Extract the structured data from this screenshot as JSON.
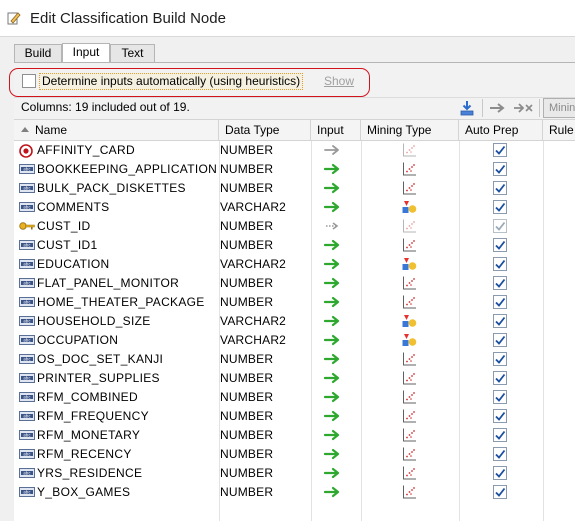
{
  "window": {
    "title": "Edit Classification Build Node"
  },
  "tabs": [
    {
      "label": "Build",
      "active": false
    },
    {
      "label": "Input",
      "active": true
    },
    {
      "label": "Text",
      "active": false
    }
  ],
  "options": {
    "determine_label": "Determine inputs automatically (using heuristics)",
    "determine_checked": false,
    "show_link": "Show"
  },
  "toolbar": {
    "columns_info": "Columns: 19 included out of 19.",
    "mining_button": "Minin"
  },
  "columns": [
    "Name",
    "Data Type",
    "Input",
    "Mining Type",
    "Auto Prep",
    "Rule"
  ],
  "rows": [
    {
      "name": "AFFINITY_CARD",
      "type": "NUMBER",
      "icon": "target-icon",
      "input": "gray",
      "mining": "numeric",
      "mining_dim": true,
      "auto": true,
      "auto_dim": false
    },
    {
      "name": "BOOKKEEPING_APPLICATION",
      "type": "NUMBER",
      "icon": "column-icon",
      "input": "green",
      "mining": "numeric",
      "mining_dim": false,
      "auto": true,
      "auto_dim": false
    },
    {
      "name": "BULK_PACK_DISKETTES",
      "type": "NUMBER",
      "icon": "column-icon",
      "input": "green",
      "mining": "numeric",
      "mining_dim": false,
      "auto": true,
      "auto_dim": false
    },
    {
      "name": "COMMENTS",
      "type": "VARCHAR2",
      "icon": "column-icon",
      "input": "green",
      "mining": "categorical",
      "mining_dim": false,
      "auto": true,
      "auto_dim": false
    },
    {
      "name": "CUST_ID",
      "type": "NUMBER",
      "icon": "key-icon",
      "input": "gray-dotted",
      "mining": "numeric",
      "mining_dim": true,
      "auto": true,
      "auto_dim": true
    },
    {
      "name": "CUST_ID1",
      "type": "NUMBER",
      "icon": "column-icon",
      "input": "green",
      "mining": "numeric",
      "mining_dim": false,
      "auto": true,
      "auto_dim": false
    },
    {
      "name": "EDUCATION",
      "type": "VARCHAR2",
      "icon": "column-icon",
      "input": "green",
      "mining": "categorical",
      "mining_dim": false,
      "auto": true,
      "auto_dim": false
    },
    {
      "name": "FLAT_PANEL_MONITOR",
      "type": "NUMBER",
      "icon": "column-icon",
      "input": "green",
      "mining": "numeric",
      "mining_dim": false,
      "auto": true,
      "auto_dim": false
    },
    {
      "name": "HOME_THEATER_PACKAGE",
      "type": "NUMBER",
      "icon": "column-icon",
      "input": "green",
      "mining": "numeric",
      "mining_dim": false,
      "auto": true,
      "auto_dim": false
    },
    {
      "name": "HOUSEHOLD_SIZE",
      "type": "VARCHAR2",
      "icon": "column-icon",
      "input": "green",
      "mining": "categorical",
      "mining_dim": false,
      "auto": true,
      "auto_dim": false
    },
    {
      "name": "OCCUPATION",
      "type": "VARCHAR2",
      "icon": "column-icon",
      "input": "green",
      "mining": "categorical",
      "mining_dim": false,
      "auto": true,
      "auto_dim": false
    },
    {
      "name": "OS_DOC_SET_KANJI",
      "type": "NUMBER",
      "icon": "column-icon",
      "input": "green",
      "mining": "numeric",
      "mining_dim": false,
      "auto": true,
      "auto_dim": false
    },
    {
      "name": "PRINTER_SUPPLIES",
      "type": "NUMBER",
      "icon": "column-icon",
      "input": "green",
      "mining": "numeric",
      "mining_dim": false,
      "auto": true,
      "auto_dim": false
    },
    {
      "name": "RFM_COMBINED",
      "type": "NUMBER",
      "icon": "column-icon",
      "input": "green",
      "mining": "numeric",
      "mining_dim": false,
      "auto": true,
      "auto_dim": false
    },
    {
      "name": "RFM_FREQUENCY",
      "type": "NUMBER",
      "icon": "column-icon",
      "input": "green",
      "mining": "numeric",
      "mining_dim": false,
      "auto": true,
      "auto_dim": false
    },
    {
      "name": "RFM_MONETARY",
      "type": "NUMBER",
      "icon": "column-icon",
      "input": "green",
      "mining": "numeric",
      "mining_dim": false,
      "auto": true,
      "auto_dim": false
    },
    {
      "name": "RFM_RECENCY",
      "type": "NUMBER",
      "icon": "column-icon",
      "input": "green",
      "mining": "numeric",
      "mining_dim": false,
      "auto": true,
      "auto_dim": false
    },
    {
      "name": "YRS_RESIDENCE",
      "type": "NUMBER",
      "icon": "column-icon",
      "input": "green",
      "mining": "numeric",
      "mining_dim": false,
      "auto": true,
      "auto_dim": false
    },
    {
      "name": "Y_BOX_GAMES",
      "type": "NUMBER",
      "icon": "column-icon",
      "input": "green",
      "mining": "numeric",
      "mining_dim": false,
      "auto": true,
      "auto_dim": false
    }
  ],
  "colors": {
    "highlight": "#d0141e",
    "green_arrow": "#2ea82e",
    "check": "#1a4fa0"
  }
}
